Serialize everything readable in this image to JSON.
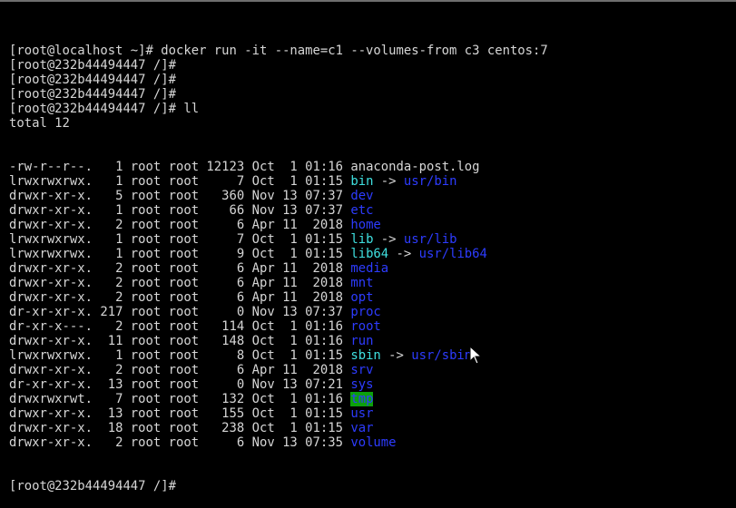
{
  "prompt_lines": [
    {
      "text": "[root@localhost ~]# docker run -it --name=c1 --volumes-from c3 centos:7"
    },
    {
      "text": "[root@232b44494447 /]#"
    },
    {
      "text": "[root@232b44494447 /]#"
    },
    {
      "text": "[root@232b44494447 /]#"
    },
    {
      "text": "[root@232b44494447 /]# ll"
    },
    {
      "text": "total 12"
    }
  ],
  "listing": [
    {
      "meta": "-rw-r--r--.   1 root root 12123 Oct  1 01:16 ",
      "name": "anaconda-post.log",
      "type": "file"
    },
    {
      "meta": "lrwxrwxrwx.   1 root root     7 Oct  1 01:15 ",
      "name": "bin",
      "type": "link",
      "target": "usr/bin"
    },
    {
      "meta": "drwxr-xr-x.   5 root root   360 Nov 13 07:37 ",
      "name": "dev",
      "type": "dir"
    },
    {
      "meta": "drwxr-xr-x.   1 root root    66 Nov 13 07:37 ",
      "name": "etc",
      "type": "dir"
    },
    {
      "meta": "drwxr-xr-x.   2 root root     6 Apr 11  2018 ",
      "name": "home",
      "type": "dir"
    },
    {
      "meta": "lrwxrwxrwx.   1 root root     7 Oct  1 01:15 ",
      "name": "lib",
      "type": "link",
      "target": "usr/lib"
    },
    {
      "meta": "lrwxrwxrwx.   1 root root     9 Oct  1 01:15 ",
      "name": "lib64",
      "type": "link",
      "target": "usr/lib64"
    },
    {
      "meta": "drwxr-xr-x.   2 root root     6 Apr 11  2018 ",
      "name": "media",
      "type": "dir"
    },
    {
      "meta": "drwxr-xr-x.   2 root root     6 Apr 11  2018 ",
      "name": "mnt",
      "type": "dir"
    },
    {
      "meta": "drwxr-xr-x.   2 root root     6 Apr 11  2018 ",
      "name": "opt",
      "type": "dir"
    },
    {
      "meta": "dr-xr-xr-x. 217 root root     0 Nov 13 07:37 ",
      "name": "proc",
      "type": "dir"
    },
    {
      "meta": "dr-xr-x---.   2 root root   114 Oct  1 01:16 ",
      "name": "root",
      "type": "dir"
    },
    {
      "meta": "drwxr-xr-x.  11 root root   148 Oct  1 01:16 ",
      "name": "run",
      "type": "dir"
    },
    {
      "meta": "lrwxrwxrwx.   1 root root     8 Oct  1 01:15 ",
      "name": "sbin",
      "type": "link",
      "target": "usr/sbin"
    },
    {
      "meta": "drwxr-xr-x.   2 root root     6 Apr 11  2018 ",
      "name": "srv",
      "type": "dir"
    },
    {
      "meta": "dr-xr-xr-x.  13 root root     0 Nov 13 07:21 ",
      "name": "sys",
      "type": "dir"
    },
    {
      "meta": "drwxrwxrwt.   7 root root   132 Oct  1 01:16 ",
      "name": "tmp",
      "type": "sticky"
    },
    {
      "meta": "drwxr-xr-x.  13 root root   155 Oct  1 01:15 ",
      "name": "usr",
      "type": "dir"
    },
    {
      "meta": "drwxr-xr-x.  18 root root   238 Oct  1 01:15 ",
      "name": "var",
      "type": "dir"
    },
    {
      "meta": "drwxr-xr-x.   2 root root     6 Nov 13 07:35 ",
      "name": "volume",
      "type": "dir"
    }
  ],
  "final_prompt": "[root@232b44494447 /]#",
  "link_arrow": " -> ",
  "colors": {
    "text": "#d6d6d6",
    "directory": "#2d3cff",
    "symlink": "#3fe0e0",
    "sticky_bg": "#0ca00c",
    "background": "#000000"
  },
  "icons": {
    "pointer": "mouse-pointer-icon"
  }
}
